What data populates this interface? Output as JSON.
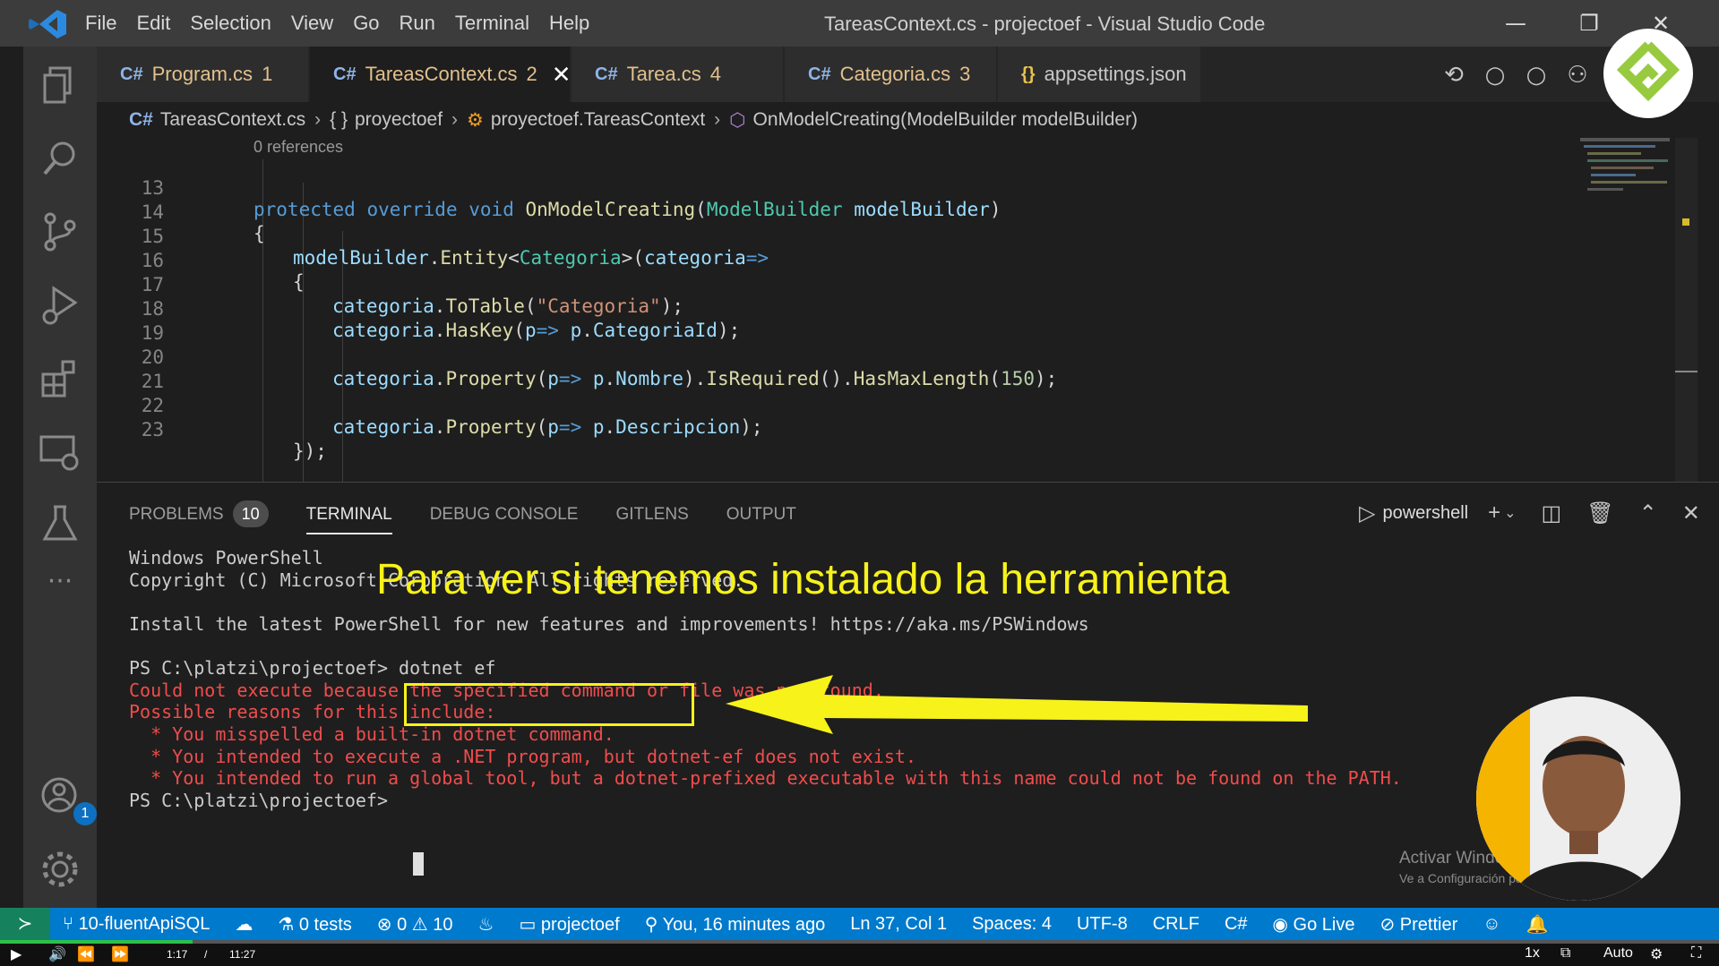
{
  "window": {
    "title": "TareasContext.cs - projectoef - Visual Studio Code",
    "menu": [
      "File",
      "Edit",
      "Selection",
      "View",
      "Go",
      "Run",
      "Terminal",
      "Help"
    ]
  },
  "tabs": [
    {
      "name": "Program.cs",
      "problems": "1",
      "icon": "C#"
    },
    {
      "name": "TareasContext.cs",
      "problems": "2",
      "icon": "C#"
    },
    {
      "name": "Tarea.cs",
      "problems": "4",
      "icon": "C#"
    },
    {
      "name": "Categoria.cs",
      "problems": "3",
      "icon": "C#"
    },
    {
      "name": "appsettings.json",
      "problems": "",
      "icon": "{}"
    }
  ],
  "breadcrumb": {
    "file": "TareasContext.cs",
    "namespace": "proyectoef",
    "class": "proyectoef.TareasContext",
    "method": "OnModelCreating(ModelBuilder modelBuilder)"
  },
  "editor": {
    "codelens": "0 references",
    "line_numbers": [
      "13",
      "14",
      "15",
      "16",
      "17",
      "18",
      "19",
      "20",
      "21",
      "22",
      "23"
    ],
    "tokens": {
      "l13": [
        "protected",
        "override",
        "void",
        "OnModelCreating",
        "(",
        "ModelBuilder",
        "modelBuilder",
        ")"
      ],
      "l14": "{",
      "l15": [
        "modelBuilder",
        ".",
        "Entity",
        "<",
        "Categoria",
        ">(",
        "categoria",
        "=>"
      ],
      "l16": "{",
      "l17": [
        "categoria",
        ".",
        "ToTable",
        "(",
        "\"Categoria\"",
        ");"
      ],
      "l18": [
        "categoria",
        ".",
        "HasKey",
        "(",
        "p",
        "=> ",
        "p",
        ".",
        "CategoriaId",
        ");"
      ],
      "l20": [
        "categoria",
        ".",
        "Property",
        "(",
        "p",
        "=> ",
        "p",
        ".",
        "Nombre",
        ").",
        "IsRequired",
        "().",
        "HasMaxLength",
        "(",
        "150",
        ");"
      ],
      "l22": [
        "categoria",
        ".",
        "Property",
        "(",
        "p",
        "=> ",
        "p",
        ".",
        "Descripcion",
        ");"
      ],
      "l23": "});"
    }
  },
  "panel": {
    "tabs": [
      "PROBLEMS",
      "TERMINAL",
      "DEBUG CONSOLE",
      "GITLENS",
      "OUTPUT"
    ],
    "problems_count": "10",
    "shell": "powershell"
  },
  "terminal": {
    "lines": [
      "Windows PowerShell",
      "Copyright (C) Microsoft Corporation. All rights reserved.",
      "",
      "Install the latest PowerShell for new features and improvements! https://aka.ms/PSWindows",
      "",
      "PS C:\\platzi\\projectoef> ",
      "Could not execute because the specified command or file was not found.",
      "Possible reasons for this include:",
      "  * You misspelled a built-in dotnet command.",
      "  * You intended to execute a .NET program, but dotnet-ef does not exist.",
      "  * You intended to run a global tool, but a dotnet-prefixed executable with this name could not be found on the PATH.",
      "PS C:\\platzi\\projectoef> "
    ],
    "command": "dotnet ef"
  },
  "overlay": {
    "caption": "Para ver si tenemos instalado la herramienta",
    "watermark_title": "Activar Windows",
    "watermark_sub": "Ve a Configuración para activar Windows."
  },
  "statusbar": {
    "branch": "10-fluentApiSQL",
    "tests": "0 tests",
    "errors": "0",
    "warnings": "10",
    "project": "projectoef",
    "blame": "You, 16 minutes ago",
    "position": "Ln 37, Col 1",
    "spaces": "Spaces: 4",
    "encoding": "UTF-8",
    "eol": "CRLF",
    "language": "C#",
    "golive": "Go Live",
    "prettier": "Prettier"
  },
  "player": {
    "current": "1:17",
    "separator": "/",
    "total": "11:27",
    "speed": "1x",
    "quality": "Auto",
    "progress_fraction": 0.112
  },
  "colors": {
    "accent": "#007acc",
    "caption": "#f7f21a",
    "error": "#f14c4c"
  }
}
